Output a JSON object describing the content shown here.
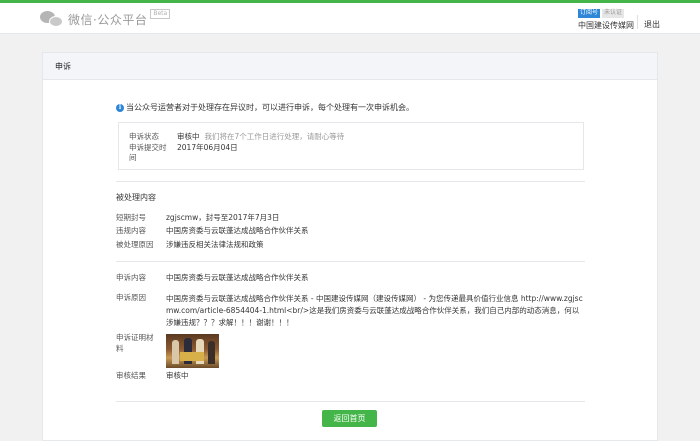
{
  "header": {
    "logo_text": "微信·公众平台",
    "beta": "Beta",
    "badge_subscription": "订阅号",
    "badge_unverified": "未认证",
    "account_name": "中国建设传媒网",
    "logout": "退出"
  },
  "panel": {
    "title": "申诉"
  },
  "notice": "当公众号运营者对于处理存在异议时，可以进行申诉，每个处理有一次申诉机会。",
  "status": {
    "status_label": "申诉状态",
    "status_value": "审核中",
    "status_tip": "我们将在7个工作日进行处理，请耐心等待",
    "time_label": "申诉提交时间",
    "time_value": "2017年06月04日"
  },
  "processed": {
    "section_title": "被处理内容",
    "ban_label": "短期封号",
    "ban_value": "zgjscmw，封号至2017年7月3日",
    "content_label": "违规内容",
    "content_value": "中国房资委与云联蓬达成战略合作伙伴关系",
    "reason_label": "被处理原因",
    "reason_value": "涉嫌违反相关法律法规和政策"
  },
  "appeal": {
    "content_label": "申诉内容",
    "content_value": "中国房资委与云联蓬达成战略合作伙伴关系",
    "reason_label": "申诉原因",
    "reason_value": "中国房资委与云联蓬达成战略合作伙伴关系 - 中国建设传媒网（建设传媒网） - 为您传递最具价值行业信息 http://www.zgjscmw.com/article-6854404-1.html<br/>这是我们房资委与云联蓬达成战略合作伙伴关系，我们自己内部的动态消息，何以涉嫌违规？？？求解！！！谢谢！！！",
    "evidence_label": "申诉证明材料",
    "result_label": "审核结果",
    "result_value": "审核中"
  },
  "button": {
    "back_home": "返回首页"
  },
  "colors": {
    "brand_green": "#44b549",
    "link_blue": "#2f86d6"
  }
}
